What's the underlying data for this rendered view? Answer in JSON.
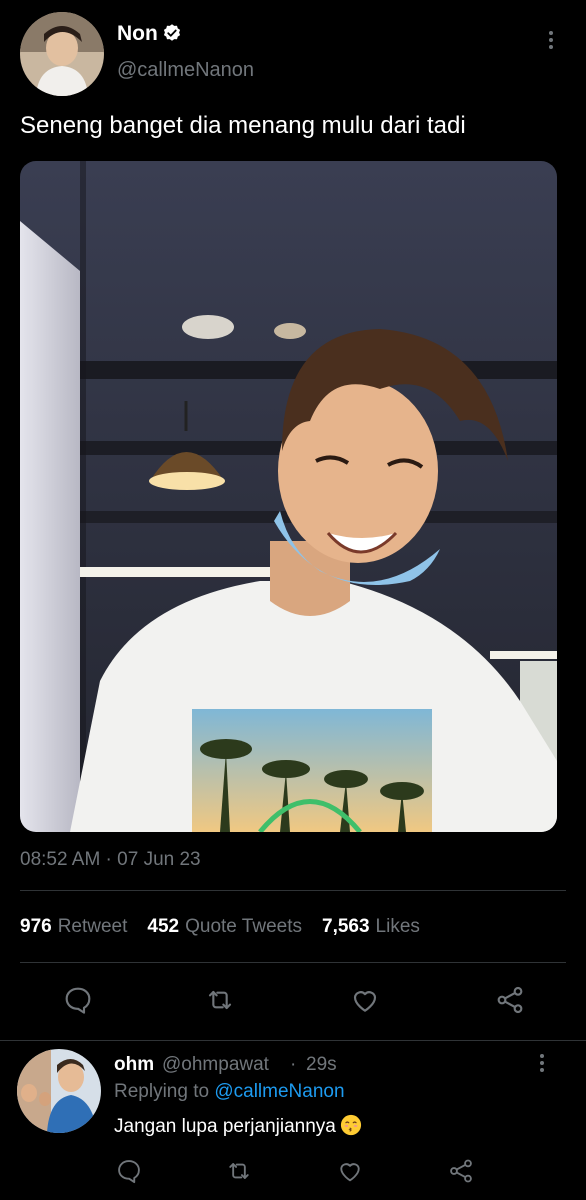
{
  "tweet": {
    "author_name": "Non",
    "author_handle": "@callmeNanon",
    "text": "Seneng banget dia menang mulu dari tadi",
    "timestamp": "08:52 AM · 07 Jun 23"
  },
  "stats": [
    {
      "value": "976",
      "label": "Retweet"
    },
    {
      "value": "452",
      "label": "Quote Tweets"
    },
    {
      "value": "7,563",
      "label": "Likes"
    }
  ],
  "actions": [
    "reply-icon",
    "retweet-icon",
    "like-icon",
    "share-icon"
  ],
  "reply": {
    "name": "ohm",
    "handle": "@ohmpawat",
    "separator": "·",
    "time": "29s",
    "replying_prefix": "Replying to",
    "replying_target": "@callmeNanon",
    "text": "Jangan lupa perjanjiannya",
    "emoji": "kissing-face-icon"
  },
  "colors": {
    "background": "#000000",
    "secondary_text": "#71767b",
    "link": "#1d9bf0",
    "verified_badge": "#ffffff"
  }
}
